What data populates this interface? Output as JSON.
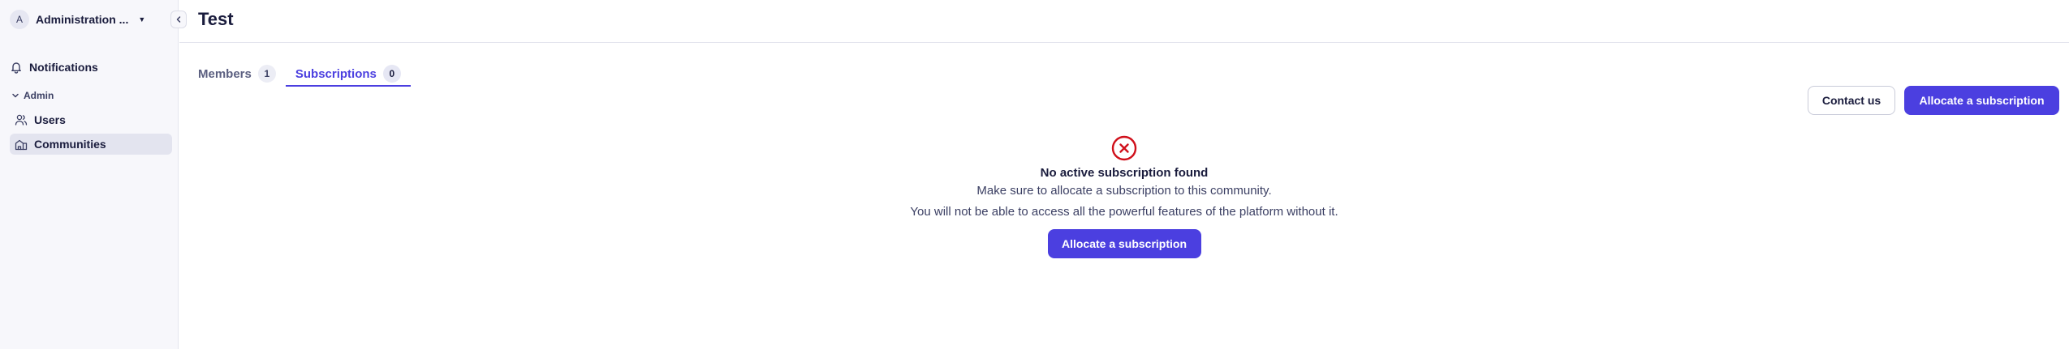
{
  "sidebar": {
    "org": {
      "avatar_letter": "A",
      "name": "Administration ..."
    },
    "notifications_label": "Notifications",
    "section_label": "Admin",
    "items": [
      {
        "label": "Users"
      },
      {
        "label": "Communities",
        "active": true
      }
    ]
  },
  "header": {
    "title": "Test"
  },
  "tabs": [
    {
      "label": "Members",
      "count": "1"
    },
    {
      "label": "Subscriptions",
      "count": "0",
      "active": true
    }
  ],
  "actions": {
    "contact_label": "Contact us",
    "allocate_label": "Allocate a subscription"
  },
  "empty_state": {
    "title": "No active subscription found",
    "line1": "Make sure to allocate a subscription to this community.",
    "line2": "You will not be able to access all the powerful features of the platform without it.",
    "button_label": "Allocate a subscription"
  },
  "colors": {
    "accent": "#4b3fe0",
    "error": "#d0101b",
    "sidebar_bg": "#f7f7fb",
    "active_item_bg": "#e3e4ef"
  },
  "icons": {
    "org_switch": "chevron-down-icon",
    "collapse": "chevron-left-icon",
    "notifications": "bell-icon",
    "section": "chevron-down-icon",
    "users": "users-icon",
    "communities": "home-icon",
    "empty_state": "error-circle-icon"
  }
}
